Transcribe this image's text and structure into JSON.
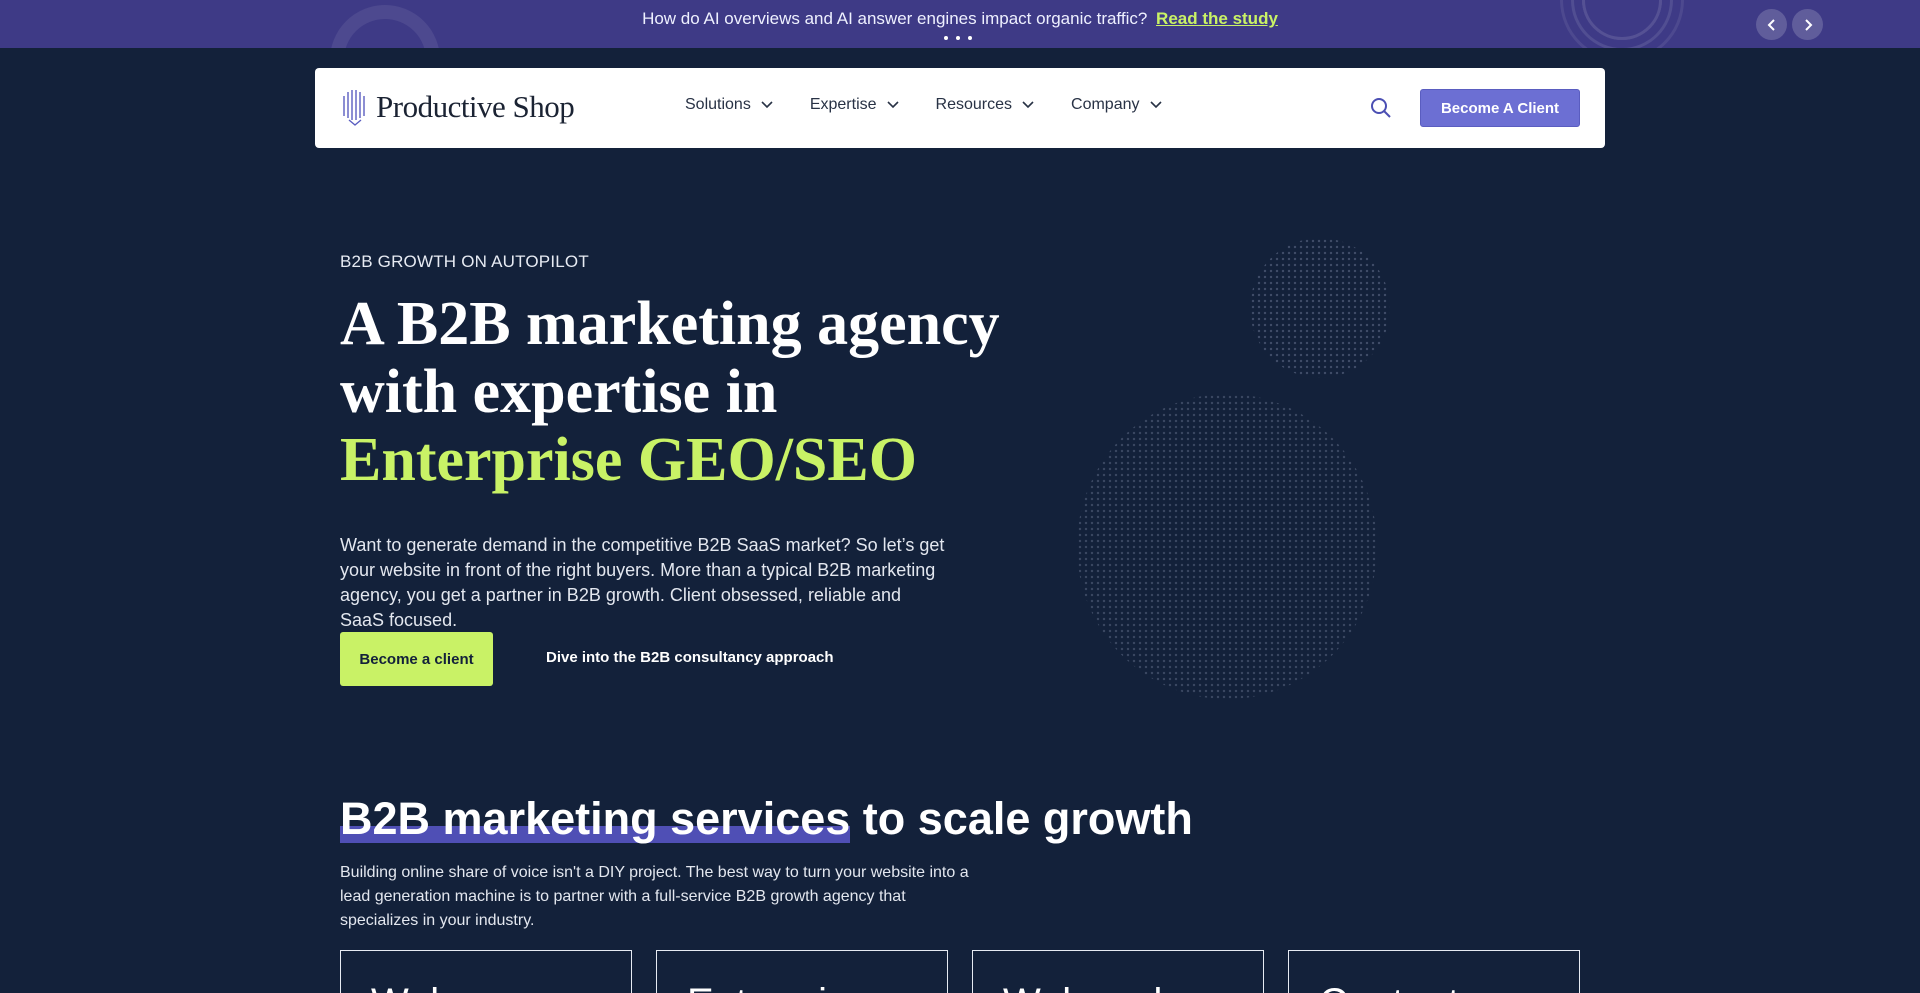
{
  "announcement": {
    "text": "How do AI overviews and AI answer engines impact organic traffic?",
    "link": "Read the study",
    "prev_icon": "chevron-left-icon",
    "next_icon": "chevron-right-icon"
  },
  "header": {
    "logo_text": "Productive Shop",
    "nav": [
      {
        "label": "Solutions"
      },
      {
        "label": "Expertise"
      },
      {
        "label": "Resources"
      },
      {
        "label": "Company"
      }
    ],
    "search_icon": "search-icon",
    "cta": "Become A Client"
  },
  "hero": {
    "eyebrow": "B2B GROWTH ON AUTOPILOT",
    "title_line1": "A B2B marketing agency",
    "title_line2": "with expertise in",
    "title_accent": "Enterprise GEO/SEO",
    "description": "Want to generate demand in the competitive B2B SaaS market? So let’s get your website in front of the right buyers. More than a typical B2B marketing agency, you get a partner in B2B growth. Client obsessed, reliable and SaaS focused.",
    "primary_button": "Become a client",
    "secondary_link": "Dive into the B2B consultancy approach"
  },
  "services": {
    "title_highlight": "B2B marketing services",
    "title_rest": " to scale growth",
    "description": "Building online share of voice isn't a DIY project. The best way to turn your website into a lead generation machine is to partner with a full-service B2B growth agency that specializes in your industry.",
    "cards": [
      {
        "title": "Web"
      },
      {
        "title": "Enterpri"
      },
      {
        "title": "Web and"
      },
      {
        "title": "Content"
      }
    ]
  },
  "colors": {
    "background": "#13213a",
    "announcement": "#3e3a86",
    "accent_green": "#c9f266",
    "accent_purple": "#6c6fd3"
  }
}
